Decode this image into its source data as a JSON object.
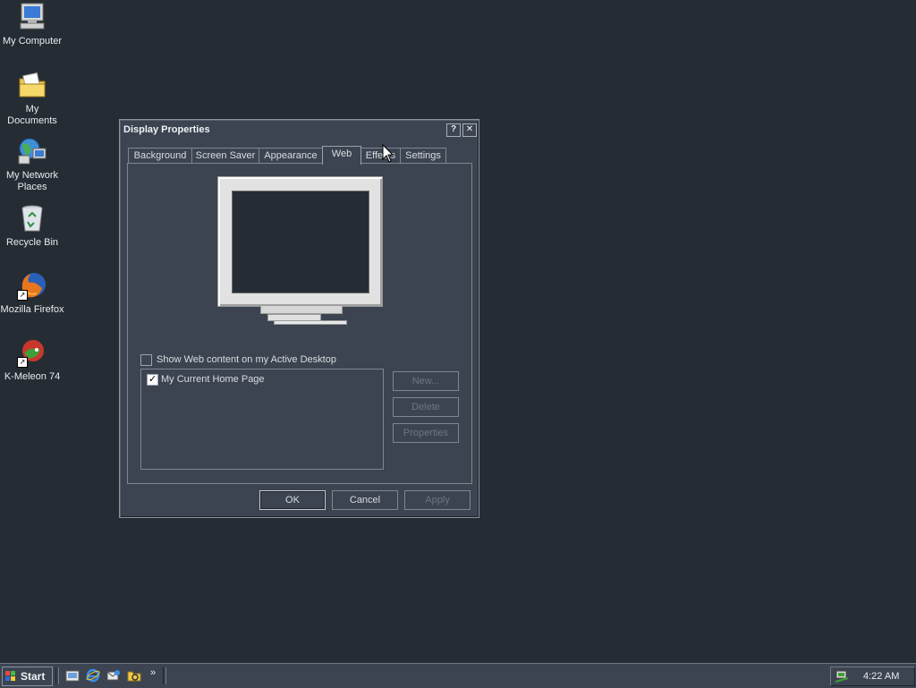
{
  "desktop": {
    "icons": [
      {
        "label": "My Computer",
        "icon": "my-computer-icon"
      },
      {
        "label": "My Documents",
        "icon": "my-documents-icon"
      },
      {
        "label": "My Network Places",
        "icon": "network-places-icon"
      },
      {
        "label": "Recycle Bin",
        "icon": "recycle-bin-icon"
      },
      {
        "label": "Mozilla Firefox",
        "icon": "firefox-icon"
      },
      {
        "label": "K-Meleon 74",
        "icon": "k-meleon-icon"
      }
    ]
  },
  "dialog": {
    "title": "Display Properties",
    "help_button": "?",
    "close_button": "✕",
    "tabs": [
      {
        "label": "Background",
        "active": false
      },
      {
        "label": "Screen Saver",
        "active": false
      },
      {
        "label": "Appearance",
        "active": false
      },
      {
        "label": "Web",
        "active": true
      },
      {
        "label": "Effects",
        "active": false
      },
      {
        "label": "Settings",
        "active": false
      }
    ],
    "web": {
      "show_web_content_label": "Show Web content on my Active Desktop",
      "show_web_content_checked": false,
      "items": [
        {
          "label": "My Current Home Page",
          "checked": true
        }
      ],
      "buttons": {
        "new": "New...",
        "delete": "Delete",
        "properties": "Properties"
      }
    },
    "footer": {
      "ok": "OK",
      "cancel": "Cancel",
      "apply": "Apply"
    }
  },
  "taskbar": {
    "start_label": "Start",
    "quick_launch": [
      "show-desktop-icon",
      "internet-explorer-icon",
      "outlook-express-icon",
      "windows-explorer-icon"
    ],
    "overflow": "»",
    "clock": "4:22 AM"
  },
  "colors": {
    "desktop": "#262c34",
    "window": "#3b4450",
    "text": "#d8dde3",
    "disabled_text": "#6d7782"
  }
}
